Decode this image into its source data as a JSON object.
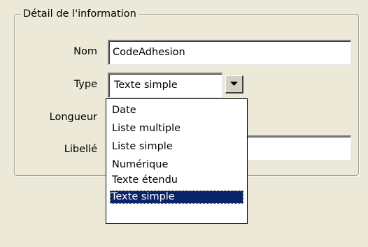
{
  "group": {
    "title": "Détail de l'information"
  },
  "form": {
    "nom_label": "Nom",
    "nom_value": "CodeAdhesion",
    "type_label": "Type",
    "type_value": "Texte simple",
    "longueur_label": "Longueur",
    "libelle_label": "Libellé",
    "libelle_value": ""
  },
  "type_options": [
    {
      "label": "Date"
    },
    {
      "label": "Liste multiple"
    },
    {
      "label": "Liste simple"
    },
    {
      "label": "Numérique"
    },
    {
      "label": "Texte étendu"
    },
    {
      "label": "Texte simple",
      "selected": true
    }
  ],
  "icons": {
    "dropdown": "chevron-down-icon"
  },
  "colors": {
    "selection": "#0a246a",
    "background": "#ece9d8"
  }
}
